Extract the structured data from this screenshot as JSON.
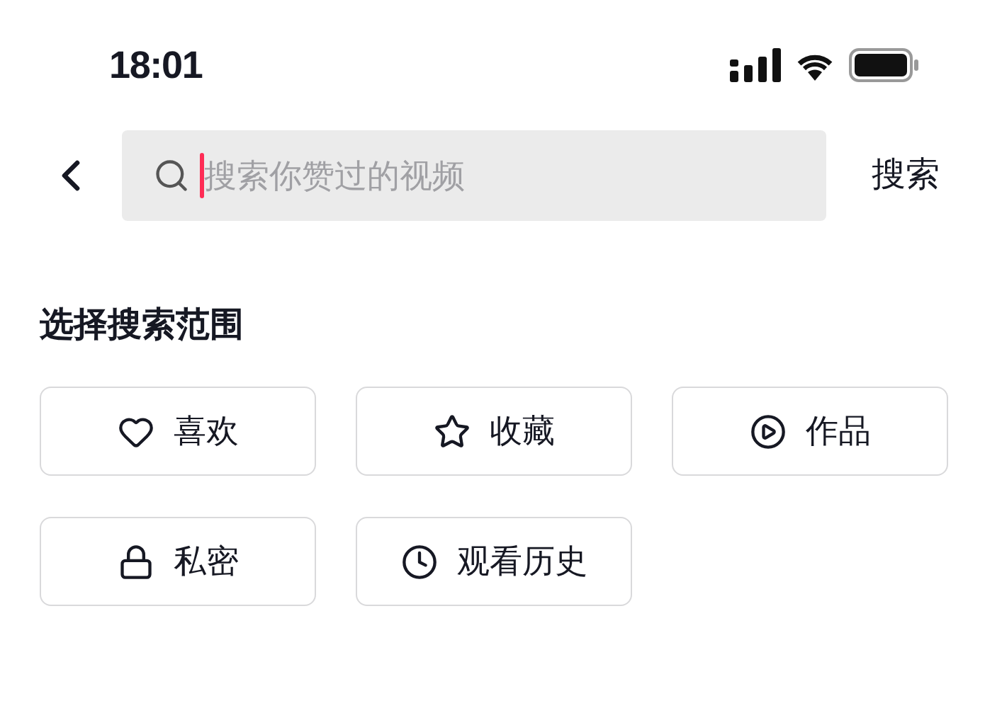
{
  "status_bar": {
    "time": "18:01"
  },
  "search": {
    "placeholder": "搜索你赞过的视频",
    "button": "搜索"
  },
  "scope": {
    "title": "选择搜索范围",
    "options": [
      {
        "label": "喜欢",
        "kind": "heart"
      },
      {
        "label": "收藏",
        "kind": "star"
      },
      {
        "label": "作品",
        "kind": "play"
      },
      {
        "label": "私密",
        "kind": "lock"
      },
      {
        "label": "观看历史",
        "kind": "clock"
      }
    ]
  }
}
